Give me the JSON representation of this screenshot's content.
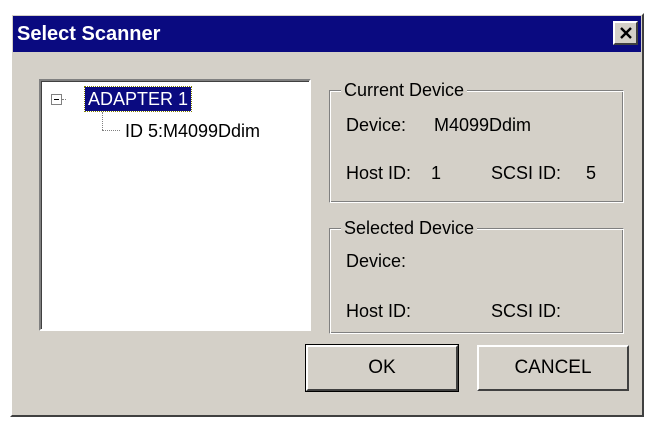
{
  "window": {
    "title": "Select Scanner",
    "close_icon": "close-icon"
  },
  "tree": {
    "root_label": "ADAPTER 1",
    "root_expanded": true,
    "root_selected": true,
    "child_label": "ID 5:M4099Ddim"
  },
  "current_device": {
    "legend": "Current Device",
    "device_label": "Device:",
    "device_value": "M4099Ddim",
    "host_id_label": "Host ID:",
    "host_id_value": "1",
    "scsi_id_label": "SCSI ID:",
    "scsi_id_value": "5"
  },
  "selected_device": {
    "legend": "Selected Device",
    "device_label": "Device:",
    "device_value": "",
    "host_id_label": "Host ID:",
    "host_id_value": "",
    "scsi_id_label": "SCSI ID:",
    "scsi_id_value": ""
  },
  "buttons": {
    "ok_label": "OK",
    "cancel_label": "CANCEL"
  },
  "colors": {
    "titlebar": "#0a0a80",
    "dialog_face": "#d4d0c8",
    "selection": "#0a0a80"
  }
}
